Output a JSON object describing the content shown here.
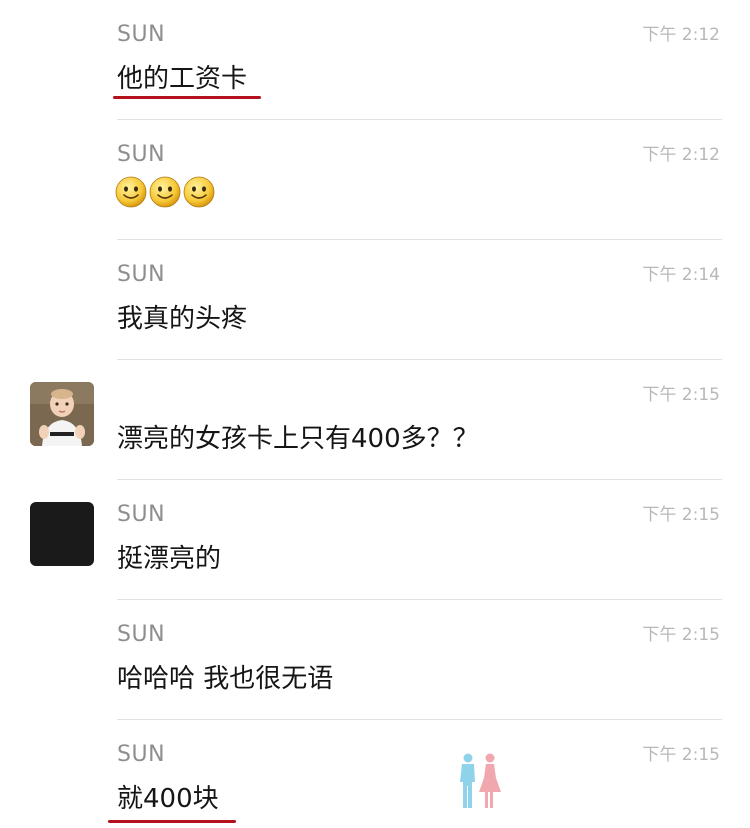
{
  "messages": [
    {
      "sender": "SUN",
      "time": "下午 2:12",
      "text": "他的工资卡"
    },
    {
      "sender": "SUN",
      "time": "下午 2:12",
      "emoji": [
        "smiling-face-emoji",
        "smiling-face-emoji",
        "smiling-face-emoji"
      ]
    },
    {
      "sender": "SUN",
      "time": "下午 2:14",
      "text": "我真的头疼"
    },
    {
      "sender": "",
      "time": "下午 2:15",
      "text": "漂亮的女孩卡上只有400多？？",
      "avatar": "baby-photo-avatar"
    },
    {
      "sender": "SUN",
      "time": "下午 2:15",
      "text": "挺漂亮的",
      "avatar": "black-avatar"
    },
    {
      "sender": "SUN",
      "time": "下午 2:15",
      "text": "哈哈哈 我也很无语"
    },
    {
      "sender": "SUN",
      "time": "下午 2:15",
      "text": "就400块"
    }
  ],
  "colors": {
    "underline": "#b3121d",
    "sender": "#8e8e8e",
    "time": "#b8b8b8",
    "text": "#151515",
    "divider": "#e2e2e2"
  },
  "watermark_icon": "couple-silhouette-icon"
}
